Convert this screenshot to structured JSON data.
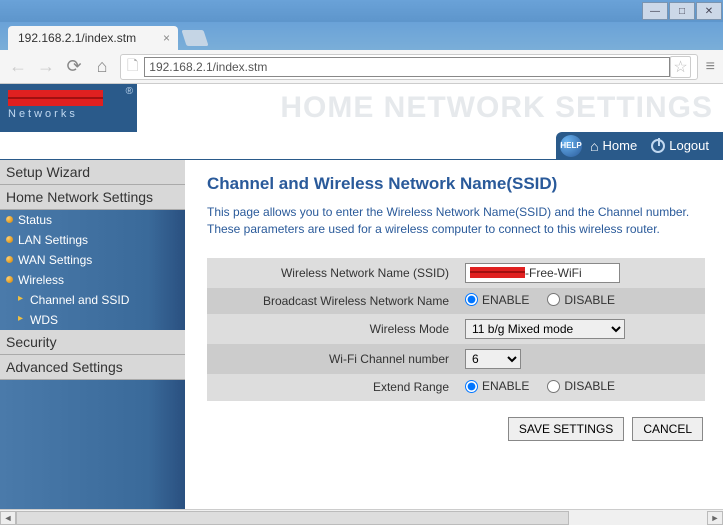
{
  "window": {
    "tab_title": "192.168.2.1/index.stm",
    "url": "192.168.2.1/index.stm"
  },
  "logo": {
    "subtitle": "Networks",
    "trademark": "®"
  },
  "banner_title": "HOME NETWORK SETTINGS",
  "topnav": {
    "help": "HELP",
    "home": "Home",
    "logout": "Logout"
  },
  "sidebar": {
    "setup_wizard": "Setup Wizard",
    "home_network": "Home Network Settings",
    "items": [
      "Status",
      "LAN Settings",
      "WAN Settings",
      "Wireless"
    ],
    "sub": [
      "Channel and SSID",
      "WDS"
    ],
    "security": "Security",
    "advanced": "Advanced Settings"
  },
  "content": {
    "heading": "Channel and Wireless Network Name(SSID)",
    "description": "This page allows you to enter the Wireless Network Name(SSID) and the Channel number. These parameters are used for a wireless computer to connect to this wireless router.",
    "labels": {
      "ssid": "Wireless Network Name (SSID)",
      "broadcast": "Broadcast Wireless Network Name",
      "mode": "Wireless Mode",
      "channel": "Wi-Fi Channel number",
      "extend": "Extend Range"
    },
    "values": {
      "ssid_suffix": "-Free-WiFi",
      "mode": "11 b/g Mixed mode",
      "channel": "6"
    },
    "radio": {
      "enable": "ENABLE",
      "disable": "DISABLE"
    },
    "buttons": {
      "save": "SAVE SETTINGS",
      "cancel": "CANCEL"
    }
  }
}
